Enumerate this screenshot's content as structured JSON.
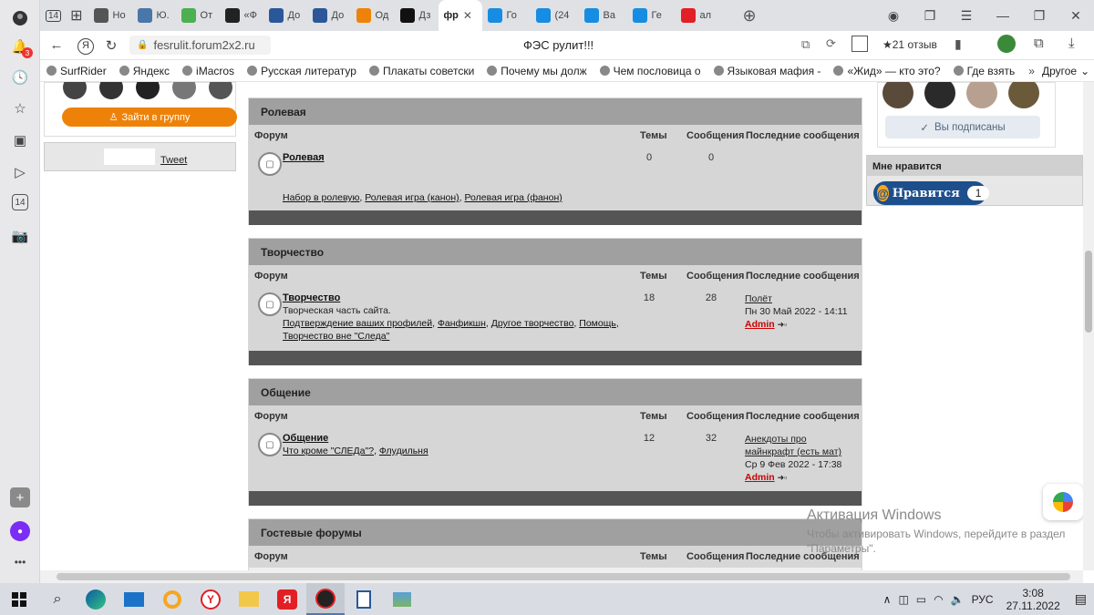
{
  "tabs": [
    {
      "label": "Но",
      "color": "#555555"
    },
    {
      "label": "Ю.",
      "color": "#4a76a8"
    },
    {
      "label": "От",
      "color": "#4caf50"
    },
    {
      "label": "«Ф",
      "color": "#222222"
    },
    {
      "label": "До",
      "color": "#2b579a"
    },
    {
      "label": "До",
      "color": "#2b579a"
    },
    {
      "label": "Од",
      "color": "#ee8208"
    },
    {
      "label": "Дз",
      "color": "#111111"
    },
    {
      "label": "Го",
      "color": "#168de2"
    },
    {
      "label": "(24",
      "color": "#168de2"
    },
    {
      "label": "Ва",
      "color": "#168de2"
    },
    {
      "label": "Ге",
      "color": "#168de2"
    },
    {
      "label": "ал",
      "color": "#e31e24"
    }
  ],
  "tab_counter": "14",
  "active_tab_icon": "фр",
  "address": {
    "url": "fesrulit.forum2x2.ru",
    "title": "ФЭС рулит!!!",
    "reviews": "★21 отзыв"
  },
  "bookmarks": [
    {
      "label": "SurfRider"
    },
    {
      "label": "Яндекс"
    },
    {
      "label": "iMacros"
    },
    {
      "label": "Русская литератур"
    },
    {
      "label": "Плакаты советски"
    },
    {
      "label": "Почему мы долж"
    },
    {
      "label": "Чем пословица о"
    },
    {
      "label": "Языковая мафия -"
    },
    {
      "label": "«Жид» — кто это?"
    },
    {
      "label": "Где взять"
    }
  ],
  "bookmarks_more": "Другое",
  "left_widget": {
    "join_button": "Зайти в группу",
    "tweet": "Tweet"
  },
  "right_widget": {
    "subscribed": "Вы подписаны",
    "likes_title": "Мне нравится",
    "like_button": "Нравится",
    "like_count": "1"
  },
  "forum_cols": {
    "forum": "Форум",
    "topics": "Темы",
    "messages": "Сообщения",
    "last": "Последние сообщения"
  },
  "categories": [
    {
      "title": "Ролевая",
      "forum": "Ролевая",
      "desc": "",
      "subforums": [
        "Набор в ролевую",
        "Ролевая игра (канон)",
        "Ролевая игра (фанон)"
      ],
      "topics": "0",
      "messages": "0",
      "last_title": "",
      "last_date": "",
      "last_author": ""
    },
    {
      "title": "Творчество",
      "forum": "Творчество",
      "desc": "Творческая часть сайта.",
      "subforums": [
        "Подтверждение ваших профилей",
        "Фанфикшн",
        "Другое творчество",
        "Помощь",
        "Творчество вне \"Следа\""
      ],
      "topics": "18",
      "messages": "28",
      "last_title": "Полёт",
      "last_date": "Пн 30 Май 2022 - 14:11",
      "last_author": "Admin"
    },
    {
      "title": "Общение",
      "forum": "Общение",
      "desc": "",
      "subforums": [
        "Что кроме \"СЛЕДа\"?",
        "Флудильня"
      ],
      "topics": "12",
      "messages": "32",
      "last_title": "Анекдоты про майнкрафт (есть мат)",
      "last_date": "Ср 9 Фев 2022 - 17:38",
      "last_author": "Admin"
    },
    {
      "title": "Гостевые форумы"
    }
  ],
  "watermark": {
    "title": "Активация Windows",
    "text": "Чтобы активировать Windows, перейдите в раздел \"Параметры\"."
  },
  "tray": {
    "lang": "РУС",
    "time": "3:08",
    "date": "27.11.2022"
  }
}
